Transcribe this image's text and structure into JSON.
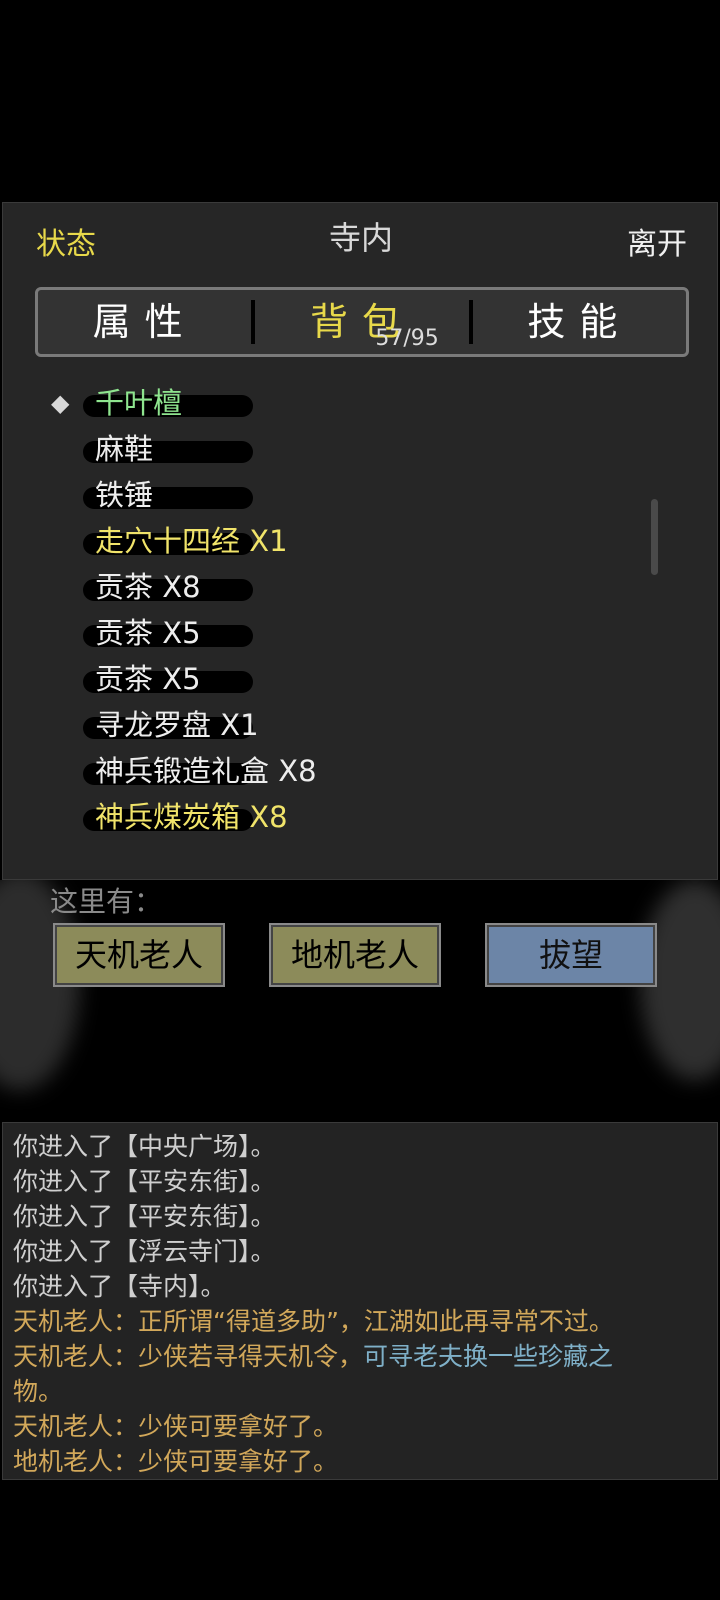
{
  "header": {
    "status_label": "状态",
    "location_title": "寺内",
    "leave_label": "离开"
  },
  "tabs": [
    {
      "label": "属性",
      "active": false
    },
    {
      "label": "背包",
      "active": true,
      "count": "57/95"
    },
    {
      "label": "技能",
      "active": false
    }
  ],
  "inventory": {
    "selected_marker": "◆",
    "items": [
      {
        "label": "千叶檀",
        "color": "green"
      },
      {
        "label": "麻鞋",
        "color": "white"
      },
      {
        "label": "铁锤",
        "color": "white"
      },
      {
        "label": "走穴十四经 X1",
        "color": "yellow"
      },
      {
        "label": "贡茶 X8",
        "color": "white"
      },
      {
        "label": "贡茶 X5",
        "color": "white"
      },
      {
        "label": "贡茶 X5",
        "color": "white"
      },
      {
        "label": "寻龙罗盘 X1",
        "color": "white"
      },
      {
        "label": "神兵锻造礼盒 X8",
        "color": "white"
      },
      {
        "label": "神兵煤炭箱 X8",
        "color": "yellow"
      }
    ]
  },
  "here": {
    "label": "这里有：",
    "buttons": [
      {
        "label": "天机老人",
        "style": "olive"
      },
      {
        "label": "地机老人",
        "style": "olive"
      },
      {
        "label": "拔望",
        "style": "blue"
      }
    ]
  },
  "log": {
    "lines": [
      {
        "parts": [
          {
            "text": "你进入了【中央广场】。",
            "style": "plain"
          }
        ]
      },
      {
        "parts": [
          {
            "text": "你进入了【平安东街】。",
            "style": "plain"
          }
        ]
      },
      {
        "parts": [
          {
            "text": "你进入了【平安东街】。",
            "style": "plain"
          }
        ]
      },
      {
        "parts": [
          {
            "text": "你进入了【浮云寺门】。",
            "style": "plain"
          }
        ]
      },
      {
        "parts": [
          {
            "text": "你进入了【寺内】。",
            "style": "plain"
          }
        ]
      },
      {
        "parts": [
          {
            "text": "天机老人：正所谓“得道多助”，江湖如此再寻常不过。",
            "style": "npc"
          }
        ]
      },
      {
        "parts": [
          {
            "text": "天机老人：少侠若寻得天机令，",
            "style": "npc"
          },
          {
            "text": "可寻老夫换一些珍藏之",
            "style": "hl"
          }
        ]
      },
      {
        "parts": [
          {
            "text": "物。",
            "style": "npc"
          }
        ]
      },
      {
        "parts": [
          {
            "text": "天机老人：少侠可要拿好了。",
            "style": "npc"
          }
        ]
      },
      {
        "parts": [
          {
            "text": "地机老人：少侠可要拿好了。",
            "style": "npc"
          }
        ]
      }
    ]
  },
  "colors": {
    "accent_yellow": "#e8d94a",
    "item_green": "#8fe58f",
    "npc_text": "#d2a85a",
    "highlight_text": "#7fb0c8"
  }
}
